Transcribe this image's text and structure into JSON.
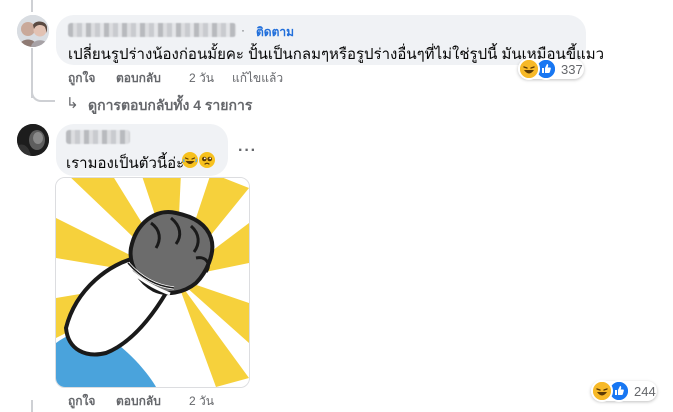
{
  "comment1": {
    "follow_label": "ติดตาม",
    "text": "เปลี่ยนรูปร่างน้องก่อนมั้ยคะ ปั้นเป็นกลมๆหรือรูปร่างอื่นๆที่ไม่ใช่รูปนี้ มันเหมือนขี้แมว",
    "like_label": "ถูกใจ",
    "reply_label": "ตอบกลับ",
    "time": "2 วัน",
    "edited_label": "แก้ไขแล้ว",
    "reaction_count": "337",
    "view_replies_label": "ดูการตอบกลับทั้ง 4 รายการ",
    "reactions": [
      "haha-icon",
      "like-icon"
    ]
  },
  "comment2": {
    "text": "เรามองเป็นตัวนี้อ่ะ",
    "more_label": "···",
    "like_label": "ถูกใจ",
    "reply_label": "ตอบกลับ",
    "time": "2 วัน",
    "reaction_count": "244",
    "reactions": [
      "haha-icon",
      "like-icon"
    ]
  },
  "colors": {
    "follow": "#216fdb",
    "bubble": "#f0f2f5",
    "secondary_text": "#65676b",
    "like_blue": "#1877f2",
    "haha_yellow": "#f7b928"
  }
}
